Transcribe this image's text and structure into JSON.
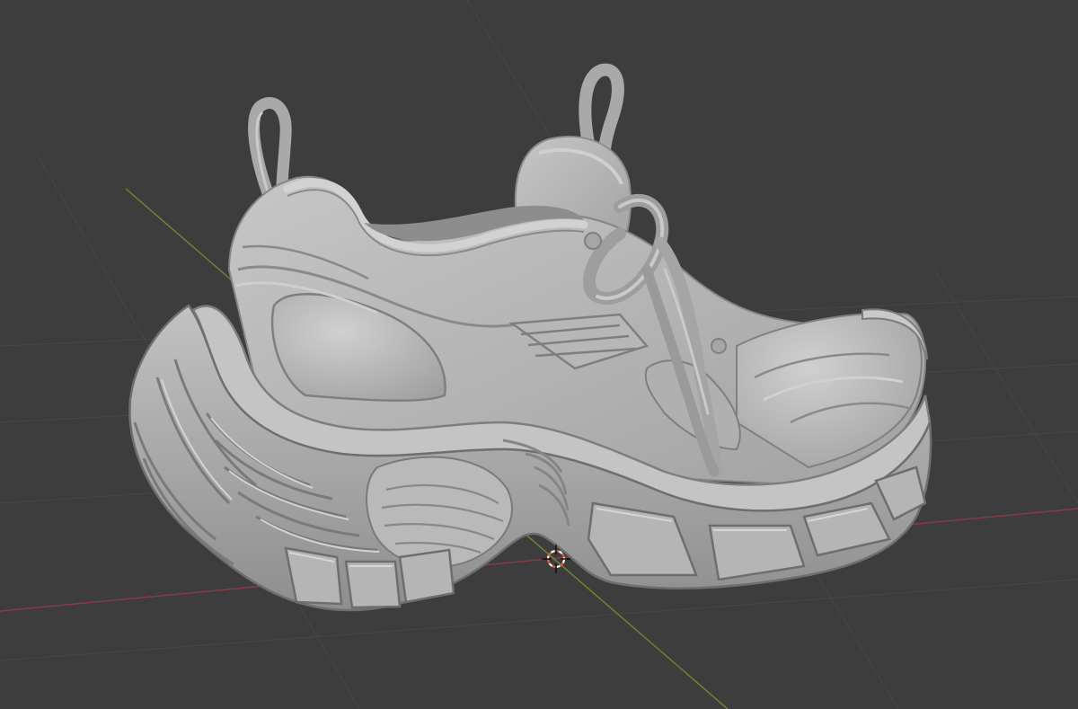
{
  "viewport": {
    "background_color": "#3d3d3d",
    "grid_line_color": "#474747",
    "x_axis_color": "#8a3b46",
    "y_axis_color": "#6d8a2e"
  },
  "model": {
    "object": "sneaker",
    "shading": "solid",
    "base_color": "#b4b4b4",
    "shadow_color": "#7a7a7a",
    "highlight_color": "#d2d2d2"
  },
  "cursor_3d": {
    "icon": "3d-cursor-icon",
    "ring_color": "#d8603a",
    "ring_alt_color": "#ffffff"
  }
}
